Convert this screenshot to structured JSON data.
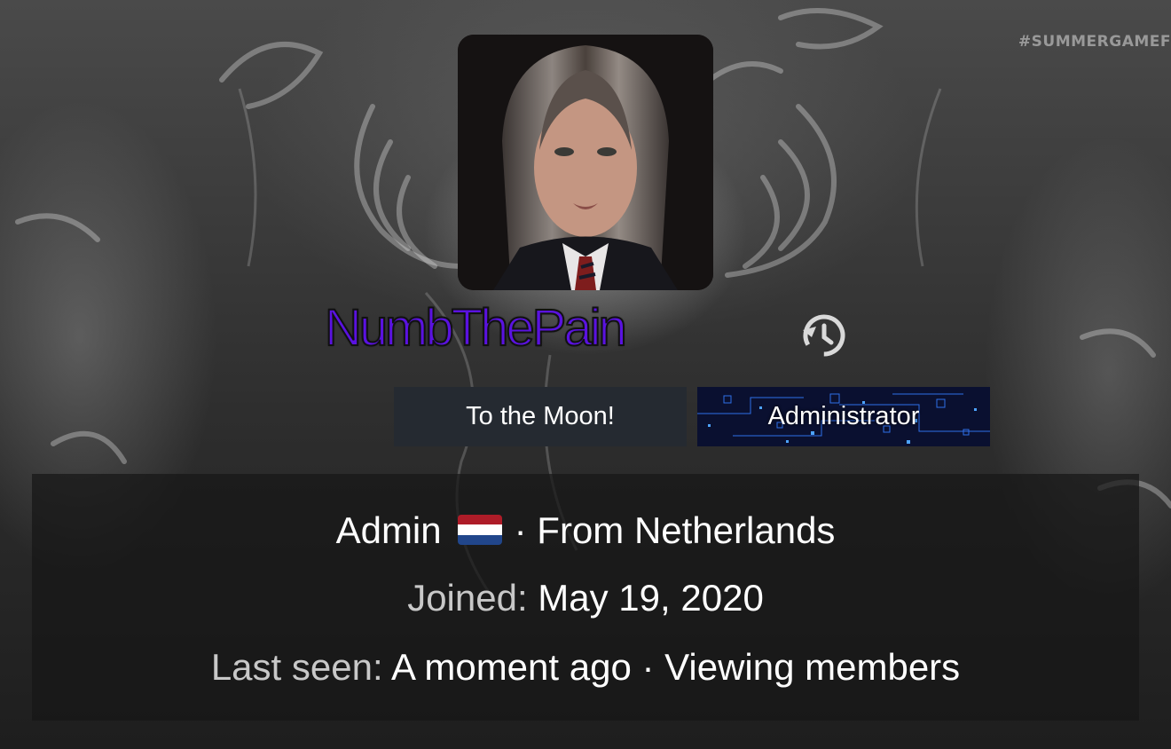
{
  "banner": {
    "hashtag": "#SUMMERGAMEF"
  },
  "profile": {
    "username": "NumbThePain",
    "username_color": "#5a12e0",
    "banners": [
      {
        "label": "To the Moon!"
      },
      {
        "label": "Administrator"
      }
    ],
    "role": "Admin",
    "flag": "netherlands-flag",
    "location_prefix": "· From ",
    "location": "Netherlands",
    "joined_label": "Joined:",
    "joined_value": "May 19, 2020",
    "last_seen_label": "Last seen:",
    "last_seen_value": "A moment ago",
    "activity": "· Viewing members"
  }
}
